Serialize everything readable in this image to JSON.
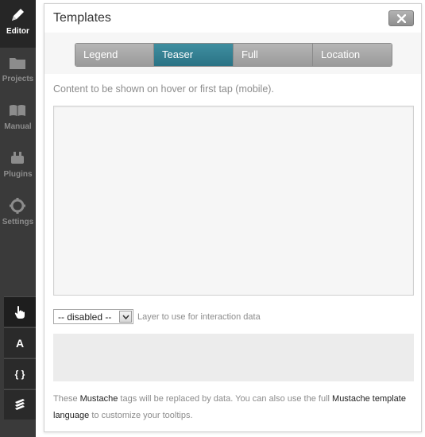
{
  "sidebar": {
    "items": [
      {
        "label": "Editor",
        "icon": "pencil-icon"
      },
      {
        "label": "Projects",
        "icon": "folder-icon"
      },
      {
        "label": "Manual",
        "icon": "book-icon"
      },
      {
        "label": "Plugins",
        "icon": "plug-icon"
      },
      {
        "label": "Settings",
        "icon": "gear-icon"
      }
    ],
    "tools": [
      {
        "icon": "hand-pointer-icon",
        "glyph": ""
      },
      {
        "icon": "text-icon",
        "glyph": "A"
      },
      {
        "icon": "braces-icon",
        "glyph": "{ }"
      },
      {
        "icon": "layers-icon",
        "glyph": ""
      }
    ]
  },
  "panel": {
    "title": "Templates",
    "tabs": [
      "Legend",
      "Teaser",
      "Full",
      "Location"
    ],
    "active_tab": "Teaser",
    "hint": "Content to be shown on hover or first tap (mobile).",
    "layer_select": {
      "value": "-- disabled --",
      "help": "Layer to use for interaction data"
    },
    "footnote": {
      "part1": "These ",
      "link1": "Mustache",
      "part2": " tags will be replaced by data. You can also use the full ",
      "link2": "Mustache template language",
      "part3": " to customize your tooltips."
    }
  },
  "colors": {
    "sidebar_bg": "#3a3a3a",
    "active_tab": "#2f7b8c",
    "tab_bg": "#a8a8a8"
  }
}
